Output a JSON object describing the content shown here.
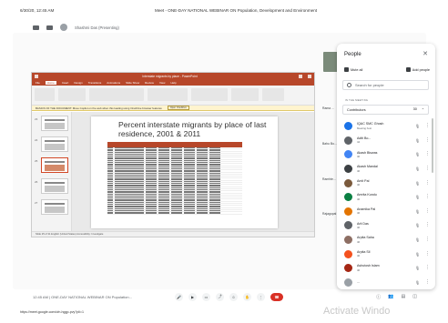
{
  "top": {
    "date": "6/30/20, 12:45 AM",
    "title": "Meet - ONE-DAY NATIONAL WEBINAR ON Population, Development and Environment"
  },
  "pin": {
    "label": "Shashmi Das (Presenting)"
  },
  "powerpoint": {
    "window_title": "Interstate migrants by place - PowerPoint",
    "menu": [
      "File",
      "Home",
      "Insert",
      "Design",
      "Transitions",
      "Animations",
      "Slide Show",
      "Review",
      "View",
      "Help"
    ],
    "active_menu": "Home",
    "message": "BASICS OF THE DOCUMENT: Move Copilot on the web when this loading using OneDrive browser features",
    "message_button": "Open OneDrive",
    "slide_title": "Percent interstate migrants by place of last residence, 2001 & 2011",
    "thumb_numbers": [
      "23",
      "24",
      "25",
      "26",
      "27"
    ],
    "status": "Slide 25 of 31   English (United States)   Accessibility: Investigate"
  },
  "tiles": [
    {
      "name": "Rama ..."
    },
    {
      "name": "Bahu Bo..."
    },
    {
      "name": "Ramhte..."
    },
    {
      "name": "Rajagopal"
    }
  ],
  "people": {
    "heading": "People",
    "mute_all": "Mute all",
    "add_people": "Add people",
    "search_placeholder": "Search for people",
    "section_label": "IN THE MEETING",
    "contributors_label": "Contributors",
    "contributors_count": "30",
    "list": [
      {
        "name": "IQAC SMC Ghosh",
        "sub": "Meeting host",
        "color": "#1a73e8"
      },
      {
        "name": "Aditi Bo...",
        "sub": "44",
        "color": "#5f6368"
      },
      {
        "name": "Akash Biswas",
        "sub": "46",
        "color": "#4285f4"
      },
      {
        "name": "Akash Mandal",
        "sub": "46",
        "color": "#3c4043"
      },
      {
        "name": "Amit Pal",
        "sub": "46",
        "color": "#7b5a3c"
      },
      {
        "name": "Amrita Kundu",
        "sub": "46",
        "color": "#0b8043"
      },
      {
        "name": "Anamika Pal",
        "sub": "46",
        "color": "#e37400"
      },
      {
        "name": "Arit Das",
        "sub": "46",
        "color": "#5f6368"
      },
      {
        "name": "Arpita Saha",
        "sub": "46",
        "color": "#8d6e63"
      },
      {
        "name": "Arpita Sil",
        "sub": "46",
        "color": "#f4511e"
      },
      {
        "name": "Ashutosh Islam",
        "sub": "46",
        "color": "#a52714"
      },
      {
        "name": "...",
        "sub": "",
        "color": "#9aa0a6"
      }
    ]
  },
  "bottom": {
    "meeting_info": "12:45 AM  |  ONE-DAY NATIONAL WEBINAR ON Population...",
    "url": "https://meet.google.com/ufn-hggp-pvy?pli=1",
    "watermark": "Activate Windo"
  }
}
